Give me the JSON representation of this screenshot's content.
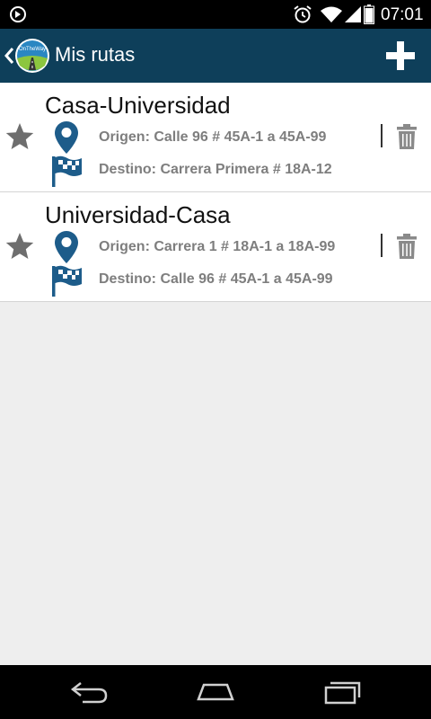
{
  "status_bar": {
    "time": "07:01",
    "icons": [
      "notification-icon",
      "alarm-icon",
      "wifi-icon",
      "signal-icon",
      "battery-icon"
    ]
  },
  "action_bar": {
    "title": "Mis rutas",
    "logo_text": "OnTheWay",
    "actions": [
      "add-icon"
    ],
    "color": "#0e3f5a"
  },
  "routes": [
    {
      "name": "Casa-Universidad",
      "origin": "Origen: Calle 96 # 45A-1 a 45A-99",
      "destination": "Destino: Carrera Primera # 18A-12"
    },
    {
      "name": "Universidad-Casa",
      "origin": "Origen: Carrera 1 # 18A-1 a 18A-99",
      "destination": "Destino: Calle 96 # 45A-1 a 45A-99"
    }
  ],
  "colors": {
    "route_icon": "#1d5c8a",
    "secondary_text": "#7e7e7e",
    "star": "#6e6e6e"
  },
  "nav_bar": {
    "buttons": [
      "back-icon",
      "home-icon",
      "recents-icon"
    ]
  }
}
